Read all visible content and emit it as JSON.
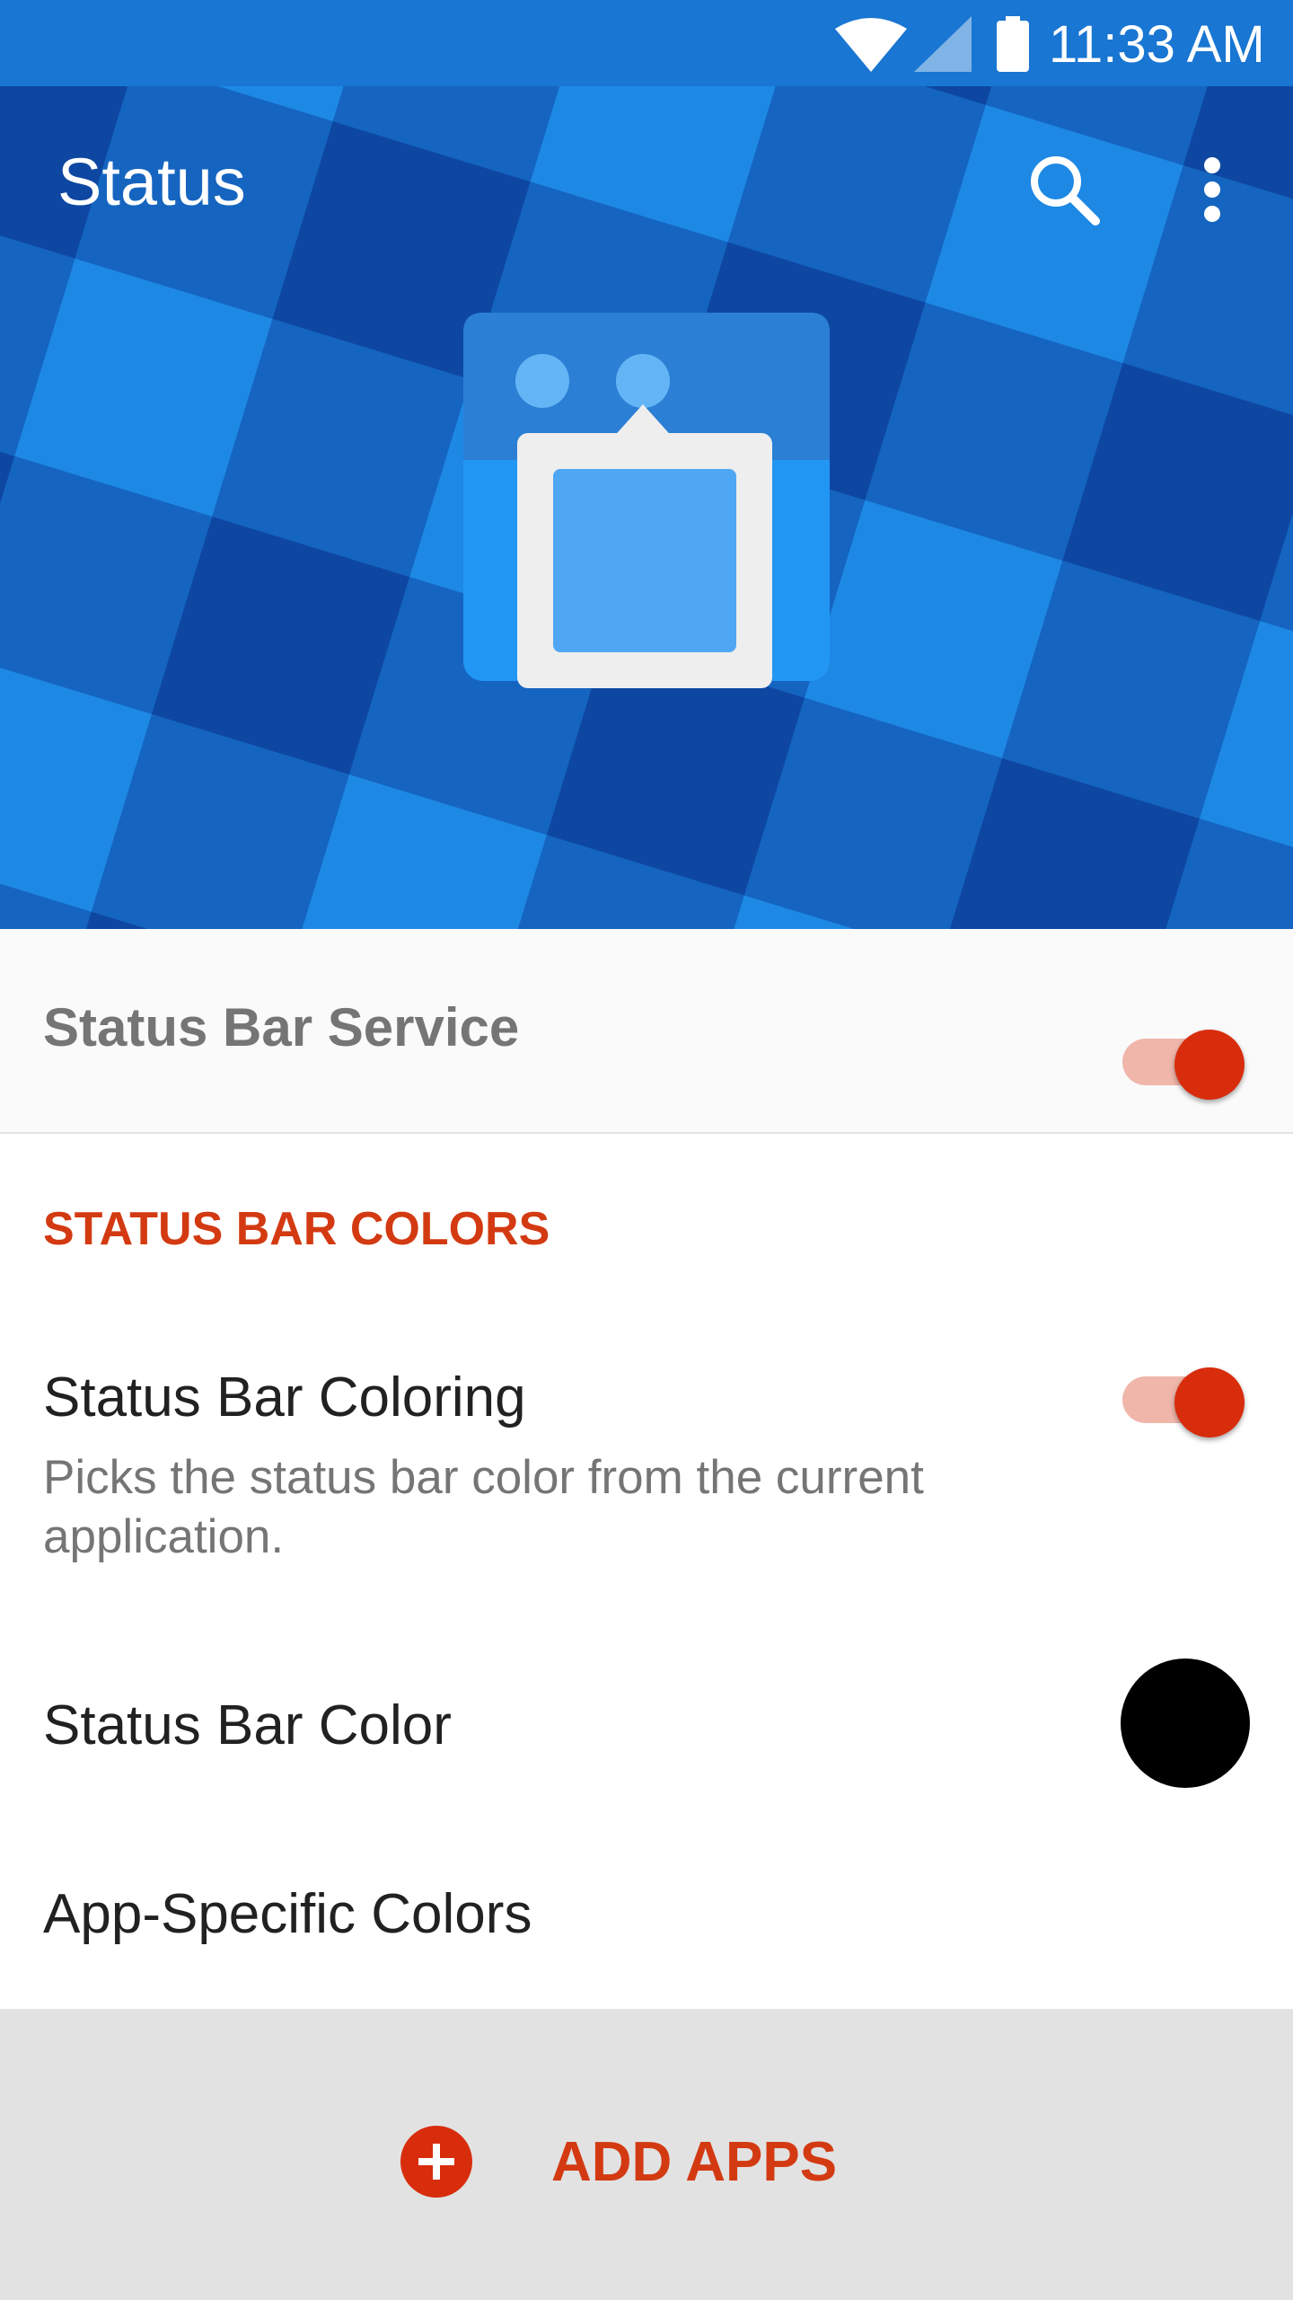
{
  "status_bar": {
    "time": "11:33 AM",
    "icons": [
      "wifi-icon",
      "cell-signal-icon",
      "battery-icon"
    ]
  },
  "app_bar": {
    "title": "Status",
    "actions": [
      "search-icon",
      "more-vert-icon"
    ]
  },
  "service": {
    "label": "Status Bar Service",
    "enabled": true
  },
  "section": {
    "header": "STATUS BAR COLORS"
  },
  "preferences": {
    "coloring": {
      "title": "Status Bar Coloring",
      "summary": "Picks the status bar color from the current application.",
      "enabled": true
    },
    "color": {
      "title": "Status Bar Color",
      "value": "#000000"
    },
    "app_specific": {
      "title": "App-Specific Colors"
    }
  },
  "add_apps": {
    "label": "ADD APPS",
    "icon": "add-circle-icon"
  },
  "colors": {
    "status_bar": "#1976d2",
    "accent": "#d82d0d",
    "accent_text": "#d33a12",
    "switch_track": "#f0b6aa",
    "header_dark": "#0d47a1",
    "header_mid": "#1565c0",
    "header_light": "#1e88e5"
  }
}
